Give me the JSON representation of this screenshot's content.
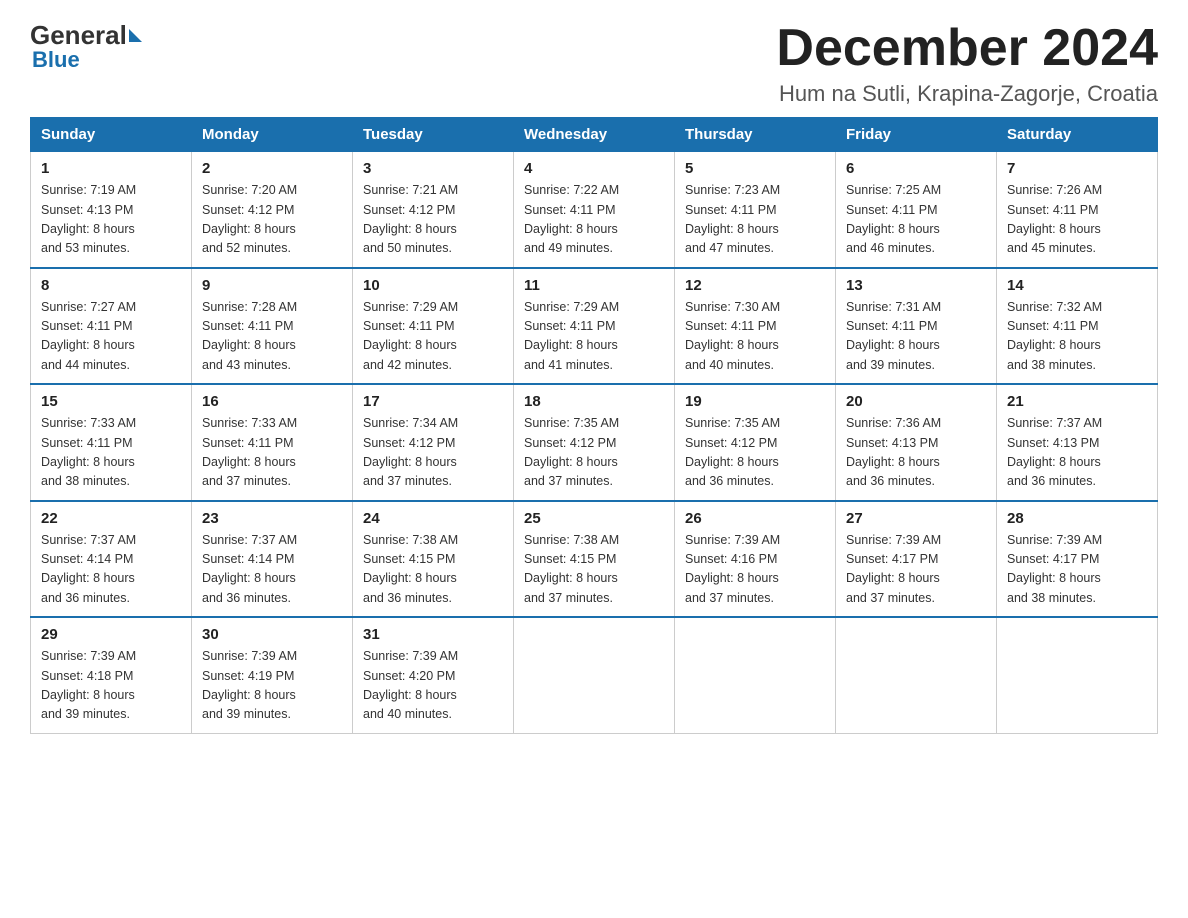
{
  "logo": {
    "general": "General",
    "blue": "Blue",
    "subtitle": "Blue"
  },
  "title": "December 2024",
  "location": "Hum na Sutli, Krapina-Zagorje, Croatia",
  "days_of_week": [
    "Sunday",
    "Monday",
    "Tuesday",
    "Wednesday",
    "Thursday",
    "Friday",
    "Saturday"
  ],
  "weeks": [
    [
      {
        "day": "1",
        "sunrise": "7:19 AM",
        "sunset": "4:13 PM",
        "daylight": "8 hours and 53 minutes."
      },
      {
        "day": "2",
        "sunrise": "7:20 AM",
        "sunset": "4:12 PM",
        "daylight": "8 hours and 52 minutes."
      },
      {
        "day": "3",
        "sunrise": "7:21 AM",
        "sunset": "4:12 PM",
        "daylight": "8 hours and 50 minutes."
      },
      {
        "day": "4",
        "sunrise": "7:22 AM",
        "sunset": "4:11 PM",
        "daylight": "8 hours and 49 minutes."
      },
      {
        "day": "5",
        "sunrise": "7:23 AM",
        "sunset": "4:11 PM",
        "daylight": "8 hours and 47 minutes."
      },
      {
        "day": "6",
        "sunrise": "7:25 AM",
        "sunset": "4:11 PM",
        "daylight": "8 hours and 46 minutes."
      },
      {
        "day": "7",
        "sunrise": "7:26 AM",
        "sunset": "4:11 PM",
        "daylight": "8 hours and 45 minutes."
      }
    ],
    [
      {
        "day": "8",
        "sunrise": "7:27 AM",
        "sunset": "4:11 PM",
        "daylight": "8 hours and 44 minutes."
      },
      {
        "day": "9",
        "sunrise": "7:28 AM",
        "sunset": "4:11 PM",
        "daylight": "8 hours and 43 minutes."
      },
      {
        "day": "10",
        "sunrise": "7:29 AM",
        "sunset": "4:11 PM",
        "daylight": "8 hours and 42 minutes."
      },
      {
        "day": "11",
        "sunrise": "7:29 AM",
        "sunset": "4:11 PM",
        "daylight": "8 hours and 41 minutes."
      },
      {
        "day": "12",
        "sunrise": "7:30 AM",
        "sunset": "4:11 PM",
        "daylight": "8 hours and 40 minutes."
      },
      {
        "day": "13",
        "sunrise": "7:31 AM",
        "sunset": "4:11 PM",
        "daylight": "8 hours and 39 minutes."
      },
      {
        "day": "14",
        "sunrise": "7:32 AM",
        "sunset": "4:11 PM",
        "daylight": "8 hours and 38 minutes."
      }
    ],
    [
      {
        "day": "15",
        "sunrise": "7:33 AM",
        "sunset": "4:11 PM",
        "daylight": "8 hours and 38 minutes."
      },
      {
        "day": "16",
        "sunrise": "7:33 AM",
        "sunset": "4:11 PM",
        "daylight": "8 hours and 37 minutes."
      },
      {
        "day": "17",
        "sunrise": "7:34 AM",
        "sunset": "4:12 PM",
        "daylight": "8 hours and 37 minutes."
      },
      {
        "day": "18",
        "sunrise": "7:35 AM",
        "sunset": "4:12 PM",
        "daylight": "8 hours and 37 minutes."
      },
      {
        "day": "19",
        "sunrise": "7:35 AM",
        "sunset": "4:12 PM",
        "daylight": "8 hours and 36 minutes."
      },
      {
        "day": "20",
        "sunrise": "7:36 AM",
        "sunset": "4:13 PM",
        "daylight": "8 hours and 36 minutes."
      },
      {
        "day": "21",
        "sunrise": "7:37 AM",
        "sunset": "4:13 PM",
        "daylight": "8 hours and 36 minutes."
      }
    ],
    [
      {
        "day": "22",
        "sunrise": "7:37 AM",
        "sunset": "4:14 PM",
        "daylight": "8 hours and 36 minutes."
      },
      {
        "day": "23",
        "sunrise": "7:37 AM",
        "sunset": "4:14 PM",
        "daylight": "8 hours and 36 minutes."
      },
      {
        "day": "24",
        "sunrise": "7:38 AM",
        "sunset": "4:15 PM",
        "daylight": "8 hours and 36 minutes."
      },
      {
        "day": "25",
        "sunrise": "7:38 AM",
        "sunset": "4:15 PM",
        "daylight": "8 hours and 37 minutes."
      },
      {
        "day": "26",
        "sunrise": "7:39 AM",
        "sunset": "4:16 PM",
        "daylight": "8 hours and 37 minutes."
      },
      {
        "day": "27",
        "sunrise": "7:39 AM",
        "sunset": "4:17 PM",
        "daylight": "8 hours and 37 minutes."
      },
      {
        "day": "28",
        "sunrise": "7:39 AM",
        "sunset": "4:17 PM",
        "daylight": "8 hours and 38 minutes."
      }
    ],
    [
      {
        "day": "29",
        "sunrise": "7:39 AM",
        "sunset": "4:18 PM",
        "daylight": "8 hours and 39 minutes."
      },
      {
        "day": "30",
        "sunrise": "7:39 AM",
        "sunset": "4:19 PM",
        "daylight": "8 hours and 39 minutes."
      },
      {
        "day": "31",
        "sunrise": "7:39 AM",
        "sunset": "4:20 PM",
        "daylight": "8 hours and 40 minutes."
      },
      null,
      null,
      null,
      null
    ]
  ],
  "labels": {
    "sunrise": "Sunrise:",
    "sunset": "Sunset:",
    "daylight": "Daylight:"
  }
}
